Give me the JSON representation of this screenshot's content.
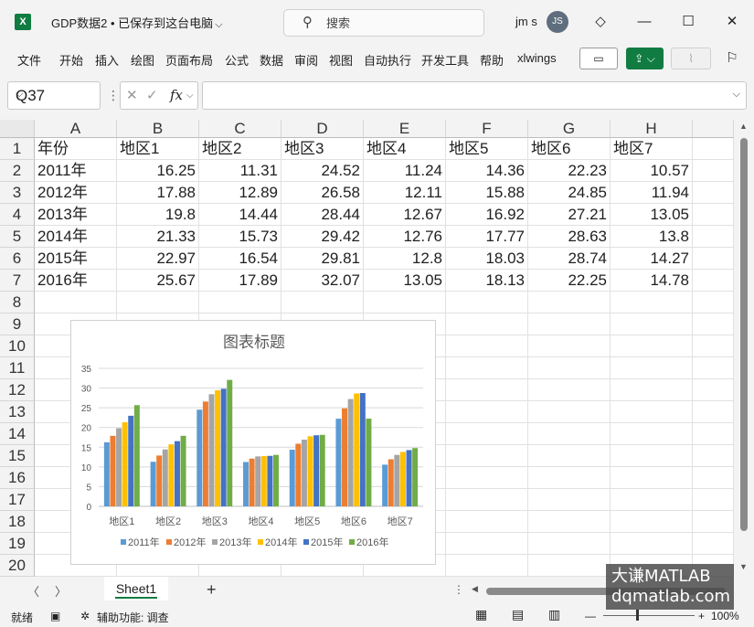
{
  "titlebar": {
    "app_icon_text": "X",
    "doc_title": "GDP数据2 • 已保存到这台电脑",
    "search_placeholder": "搜索",
    "user_name": "jm s",
    "avatar_initials": "JS"
  },
  "ribbon": {
    "menu": [
      "文件",
      "开始",
      "插入",
      "绘图",
      "页面布局",
      "公式",
      "数据",
      "审阅",
      "视图",
      "自动执行",
      "开发工具",
      "帮助",
      "xlwings"
    ]
  },
  "formula_bar": {
    "name_box": "Q37",
    "fx_label": "fx",
    "formula_value": ""
  },
  "grid": {
    "columns": [
      "A",
      "B",
      "C",
      "D",
      "E",
      "F",
      "G",
      "H"
    ],
    "rows": [
      "1",
      "2",
      "3",
      "4",
      "5",
      "6",
      "7",
      "8",
      "9",
      "10",
      "11",
      "12",
      "13",
      "14",
      "15",
      "16",
      "17",
      "18",
      "19",
      "20"
    ],
    "header_row": [
      "年份",
      "地区1",
      "地区2",
      "地区3",
      "地区4",
      "地区5",
      "地区6",
      "地区7"
    ],
    "data_rows": [
      [
        "2011年",
        "16.25",
        "11.31",
        "24.52",
        "11.24",
        "14.36",
        "22.23",
        "10.57"
      ],
      [
        "2012年",
        "17.88",
        "12.89",
        "26.58",
        "12.11",
        "15.88",
        "24.85",
        "11.94"
      ],
      [
        "2013年",
        "19.8",
        "14.44",
        "28.44",
        "12.67",
        "16.92",
        "27.21",
        "13.05"
      ],
      [
        "2014年",
        "21.33",
        "15.73",
        "29.42",
        "12.76",
        "17.77",
        "28.63",
        "13.8"
      ],
      [
        "2015年",
        "22.97",
        "16.54",
        "29.81",
        "12.8",
        "18.03",
        "28.74",
        "14.27"
      ],
      [
        "2016年",
        "25.67",
        "17.89",
        "32.07",
        "13.05",
        "18.13",
        "22.25",
        "14.78"
      ]
    ]
  },
  "chart_data": {
    "type": "bar",
    "title": "图表标题",
    "categories": [
      "地区1",
      "地区2",
      "地区3",
      "地区4",
      "地区5",
      "地区6",
      "地区7"
    ],
    "series": [
      {
        "name": "2011年",
        "color": "#5b9bd5",
        "values": [
          16.25,
          11.31,
          24.52,
          11.24,
          14.36,
          22.23,
          10.57
        ]
      },
      {
        "name": "2012年",
        "color": "#ed7d31",
        "values": [
          17.88,
          12.89,
          26.58,
          12.11,
          15.88,
          24.85,
          11.94
        ]
      },
      {
        "name": "2013年",
        "color": "#a5a5a5",
        "values": [
          19.8,
          14.44,
          28.44,
          12.67,
          16.92,
          27.21,
          13.05
        ]
      },
      {
        "name": "2014年",
        "color": "#ffc000",
        "values": [
          21.33,
          15.73,
          29.42,
          12.76,
          17.77,
          28.63,
          13.8
        ]
      },
      {
        "name": "2015年",
        "color": "#4472c4",
        "values": [
          22.97,
          16.54,
          29.81,
          12.8,
          18.03,
          28.74,
          14.27
        ]
      },
      {
        "name": "2016年",
        "color": "#70ad47",
        "values": [
          25.67,
          17.89,
          32.07,
          13.05,
          18.13,
          22.25,
          14.78
        ]
      }
    ],
    "ylim": [
      0,
      35
    ],
    "yticks": [
      0,
      5,
      10,
      15,
      20,
      25,
      30,
      35
    ],
    "grid": true,
    "legend": "bottom"
  },
  "sheets": {
    "active": "Sheet1",
    "add_label": "+"
  },
  "statusbar": {
    "ready": "就绪",
    "accessibility": "辅助功能: 调查",
    "zoom": "100%"
  },
  "watermark": {
    "line1": "大谦MATLAB",
    "line2": "dqmatlab.com"
  }
}
